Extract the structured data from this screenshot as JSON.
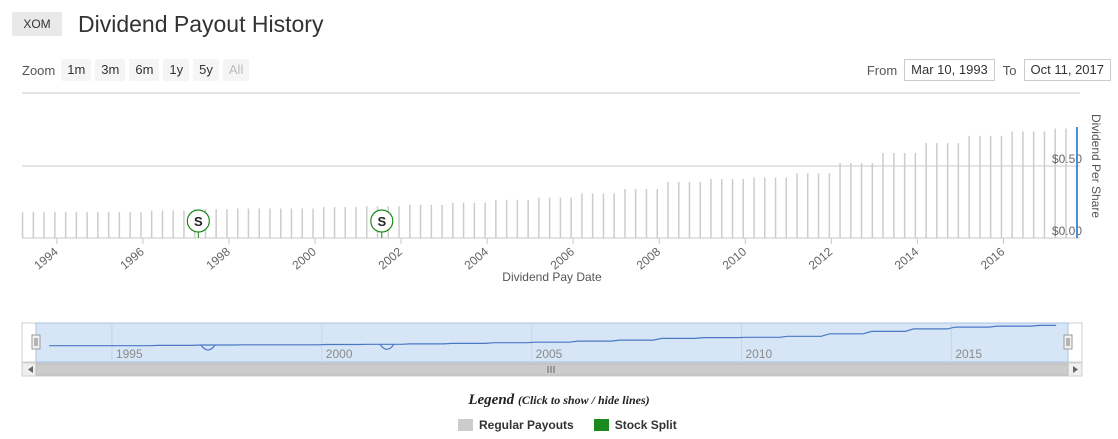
{
  "header": {
    "ticker": "XOM",
    "title": "Dividend Payout History"
  },
  "zoom": {
    "label": "Zoom",
    "buttons": [
      "1m",
      "3m",
      "6m",
      "1y",
      "5y",
      "All"
    ]
  },
  "range": {
    "from_label": "From",
    "from_value": "Mar 10, 1993",
    "to_label": "To",
    "to_value": "Oct 11, 2017"
  },
  "chart_data": {
    "type": "bar",
    "xlabel": "Dividend Pay Date",
    "ylabel": "Dividend Per Share",
    "y_ticks": [
      "$0.00",
      "$0.50"
    ],
    "ylim": [
      0,
      0.8
    ],
    "x_ticks": [
      "1994",
      "1996",
      "1998",
      "2000",
      "2002",
      "2004",
      "2006",
      "2008",
      "2010",
      "2012",
      "2014",
      "2016"
    ],
    "xlim": [
      "1993-03-10",
      "2017-10-11"
    ],
    "series": [
      {
        "name": "Regular Payouts",
        "color": "#cccccc",
        "values": [
          {
            "year": 1993,
            "amount": 0.18
          },
          {
            "year": 1994,
            "amount": 0.18
          },
          {
            "year": 1995,
            "amount": 0.18
          },
          {
            "year": 1996,
            "amount": 0.19
          },
          {
            "year": 1997,
            "amount": 0.2
          },
          {
            "year": 1998,
            "amount": 0.205
          },
          {
            "year": 1999,
            "amount": 0.205
          },
          {
            "year": 2000,
            "amount": 0.215
          },
          {
            "year": 2001,
            "amount": 0.22
          },
          {
            "year": 2002,
            "amount": 0.23
          },
          {
            "year": 2003,
            "amount": 0.245
          },
          {
            "year": 2004,
            "amount": 0.265
          },
          {
            "year": 2005,
            "amount": 0.28
          },
          {
            "year": 2006,
            "amount": 0.31
          },
          {
            "year": 2007,
            "amount": 0.34
          },
          {
            "year": 2008,
            "amount": 0.39
          },
          {
            "year": 2009,
            "amount": 0.41
          },
          {
            "year": 2010,
            "amount": 0.42
          },
          {
            "year": 2011,
            "amount": 0.45
          },
          {
            "year": 2012,
            "amount": 0.52
          },
          {
            "year": 2013,
            "amount": 0.59
          },
          {
            "year": 2014,
            "amount": 0.66
          },
          {
            "year": 2015,
            "amount": 0.71
          },
          {
            "year": 2016,
            "amount": 0.74
          },
          {
            "year": 2017,
            "amount": 0.76
          }
        ]
      },
      {
        "name": "Stock Split",
        "color": "#1a8a1a",
        "marker": "S",
        "dates": [
          "1997-04-14",
          "2001-07-19"
        ]
      }
    ],
    "navigator": {
      "labels": [
        "1995",
        "2000",
        "2005",
        "2010",
        "2015"
      ]
    },
    "legend": {
      "title": "Legend",
      "subtitle": "(Click to show / hide lines)",
      "items": [
        {
          "label": "Regular Payouts",
          "color": "#cccccc"
        },
        {
          "label": "Stock Split",
          "color": "#1a8a1a"
        }
      ]
    }
  }
}
